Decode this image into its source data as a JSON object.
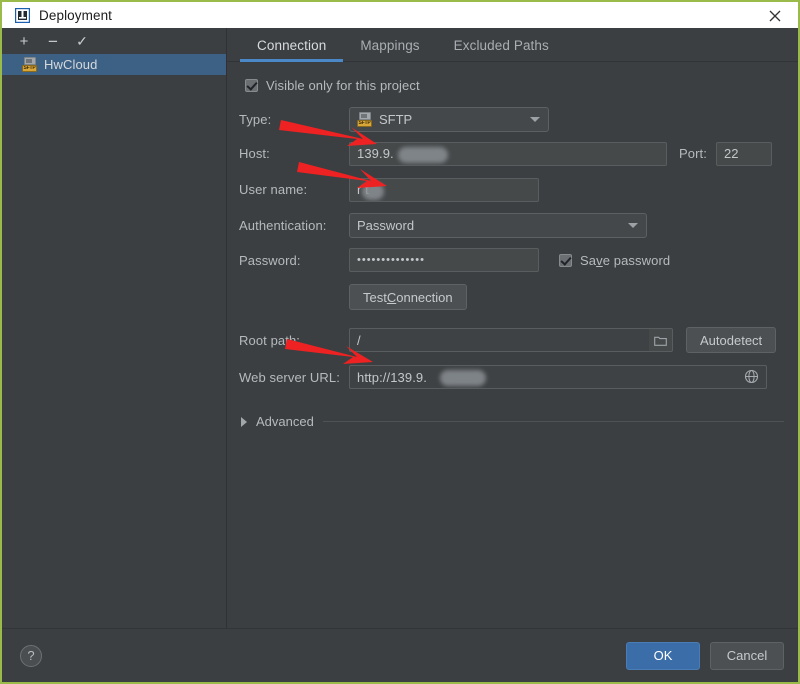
{
  "window": {
    "title": "Deployment",
    "title_icon": "deployment-icon",
    "close_icon": "close-icon",
    "accent_border": "#9aba4a"
  },
  "sidebar": {
    "toolbar": [
      {
        "name": "add-server-button",
        "glyph": "+"
      },
      {
        "name": "remove-server-button",
        "glyph": "−"
      },
      {
        "name": "set-default-server-button",
        "glyph": "✓"
      }
    ],
    "items": [
      {
        "label": "HwCloud",
        "icon": "sftp-server-icon",
        "icon_tag": "SFTP",
        "selected": true
      }
    ],
    "selected_color": "#3d6185"
  },
  "tabs": [
    {
      "label": "Connection",
      "active": true
    },
    {
      "label": "Mappings",
      "active": false
    },
    {
      "label": "Excluded Paths",
      "active": false
    }
  ],
  "tab_accent": "#4a88c7",
  "form": {
    "visible_only": {
      "label": "Visible only for this project",
      "checked": true
    },
    "type": {
      "label": "Type:",
      "value": "SFTP",
      "icon": "sftp-server-icon",
      "icon_tag": "SFTP"
    },
    "host": {
      "label": "Host:",
      "value": "139.9.",
      "redacted": true
    },
    "port": {
      "label": "Port:",
      "value": "22"
    },
    "user_name": {
      "label": "User name:",
      "value": "r     t",
      "redacted": true
    },
    "authentication": {
      "label": "Authentication:",
      "value": "Password"
    },
    "password": {
      "label": "Password:",
      "value": "••••••••••••••"
    },
    "save_password": {
      "label_pre": "Sa",
      "label_mn": "v",
      "label_post": "e password",
      "checked": true
    },
    "test_connection": {
      "label_pre": "Test ",
      "label_mn": "C",
      "label_post": "onnection"
    },
    "root_path": {
      "label": "Root path:",
      "value": "/",
      "browse_icon": "folder-icon"
    },
    "autodetect": {
      "label": "Autodetect"
    },
    "web_server_url": {
      "label": "Web server URL:",
      "value": "http://139.9.",
      "redacted": true,
      "open_icon": "globe-icon"
    },
    "advanced": {
      "label": "Advanced",
      "expanded": false,
      "chevron_icon": "chevron-right-icon"
    }
  },
  "footer": {
    "help": {
      "label": "?",
      "icon": "help-icon"
    },
    "ok": {
      "label": "OK"
    },
    "cancel": {
      "label": "Cancel"
    }
  },
  "annotations": [
    {
      "name": "arrow-host",
      "color": "#ee2222"
    },
    {
      "name": "arrow-user-name",
      "color": "#ee2222"
    },
    {
      "name": "arrow-web-server-url",
      "color": "#ee2222"
    }
  ]
}
